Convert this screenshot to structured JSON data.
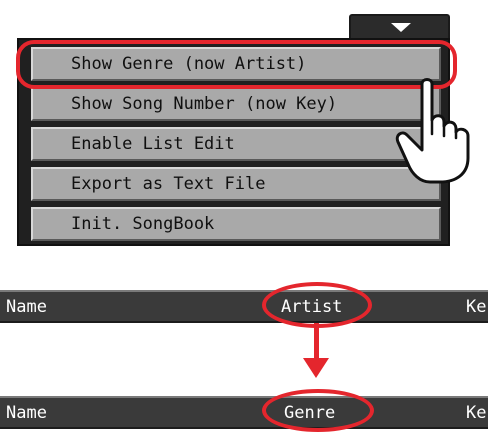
{
  "menu": {
    "items": [
      {
        "label": "Show Genre (now Artist)"
      },
      {
        "label": "Show Song Number (now Key)"
      },
      {
        "label": "Enable List Edit"
      },
      {
        "label": "Export as Text File"
      },
      {
        "label": "Init. SongBook"
      }
    ],
    "highlighted_index": 0
  },
  "header_before": {
    "name_label": "Name",
    "column_label": "Artist",
    "key_label": "Ke"
  },
  "header_after": {
    "name_label": "Name",
    "column_label": "Genre",
    "key_label": "Ke"
  },
  "colors": {
    "highlight": "#e4262d",
    "menu_item_bg": "#a9a9a9",
    "panel_bg": "#202020",
    "header_bg": "#3a3a3a"
  },
  "icons": {
    "menu_toggle": "triangle-down-icon",
    "pointer": "pointing-hand-icon",
    "arrow": "arrow-down-icon"
  }
}
